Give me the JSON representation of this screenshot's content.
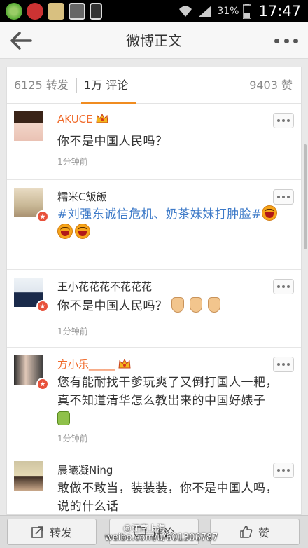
{
  "status_bar": {
    "battery": "31%",
    "time": "17:47"
  },
  "header": {
    "title": "微博正文"
  },
  "tabs": {
    "repost": "6125 转发",
    "comment": "1万 评论",
    "like": "9403 赞"
  },
  "comments": [
    {
      "username": "AKUCE",
      "text": "你不是中国人民吗？",
      "time": "1分钟前"
    },
    {
      "username": "糯米C飯飯",
      "text": "#刘强东诚信危机、奶茶妹妹打肿脸#",
      "time": ""
    },
    {
      "username": "王小花花花不花花花",
      "text": "你不是中国人民吗？",
      "time": "1分钟前"
    },
    {
      "username": "方小乐_____",
      "text": "您有能耐找干爹玩爽了又倒打国人一耙，真不知道清华怎么教出来的中国好婊子",
      "time": "1分钟前"
    },
    {
      "username": "晨曦凝Ning",
      "text": "敢做不敢当，装装装，你不是中国人吗，说的什么话",
      "time": ""
    }
  ],
  "bottom_bar": {
    "repost": "转发",
    "comment": "评论",
    "like": "赞"
  },
  "watermark": {
    "line1": "@江南上海",
    "line2": "weibo.com/u/601306787"
  },
  "colors": {
    "vip_name": "#f06a2a",
    "link": "#3d7ac8",
    "tab_underline": "#f08c20"
  }
}
